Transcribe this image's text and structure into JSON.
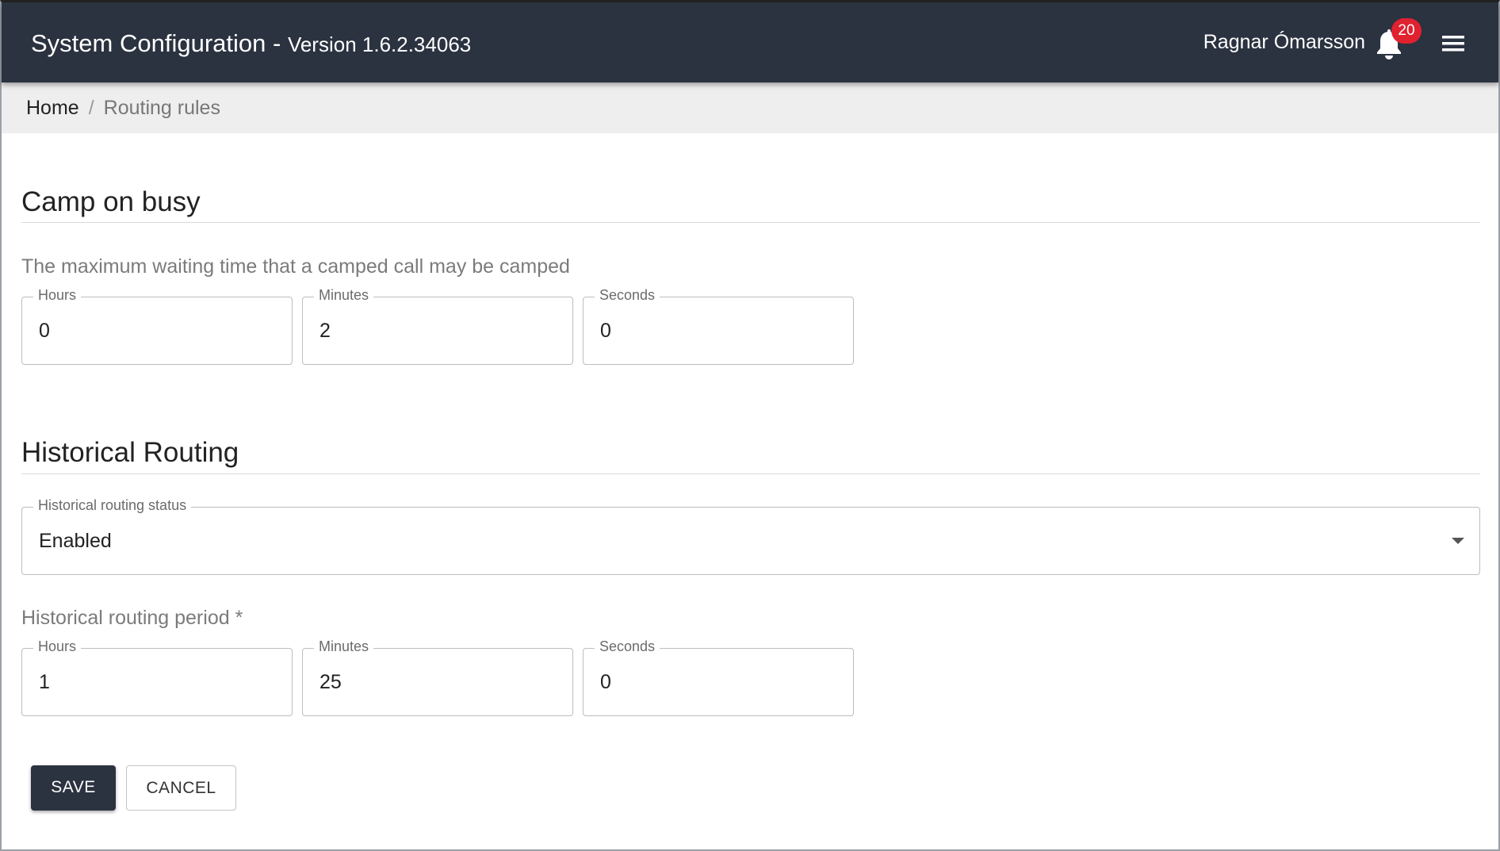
{
  "header": {
    "title": "System Configuration -",
    "version": "Version 1.6.2.34063",
    "user_name": "Ragnar Ómarsson",
    "notification_count": "20"
  },
  "breadcrumb": {
    "home": "Home",
    "separator": "/",
    "current": "Routing rules"
  },
  "camp_on_busy": {
    "title": "Camp on busy",
    "description": "The maximum waiting time that a camped call may be camped",
    "hours": {
      "label": "Hours",
      "value": "0"
    },
    "minutes": {
      "label": "Minutes",
      "value": "2"
    },
    "seconds": {
      "label": "Seconds",
      "value": "0"
    }
  },
  "historical_routing": {
    "title": "Historical Routing",
    "status": {
      "label": "Historical routing status",
      "value": "Enabled"
    },
    "period_label": "Historical routing period *",
    "hours": {
      "label": "Hours",
      "value": "1"
    },
    "minutes": {
      "label": "Minutes",
      "value": "25"
    },
    "seconds": {
      "label": "Seconds",
      "value": "0"
    }
  },
  "actions": {
    "save": "SAVE",
    "cancel": "CANCEL"
  },
  "colors": {
    "header_bg": "#2b3240",
    "badge": "#e0212f",
    "breadcrumb_bg": "#eeeeee"
  },
  "icons": {
    "notifications": "bell-icon",
    "menu": "hamburger-menu-icon",
    "dropdown": "caret-down-icon"
  }
}
